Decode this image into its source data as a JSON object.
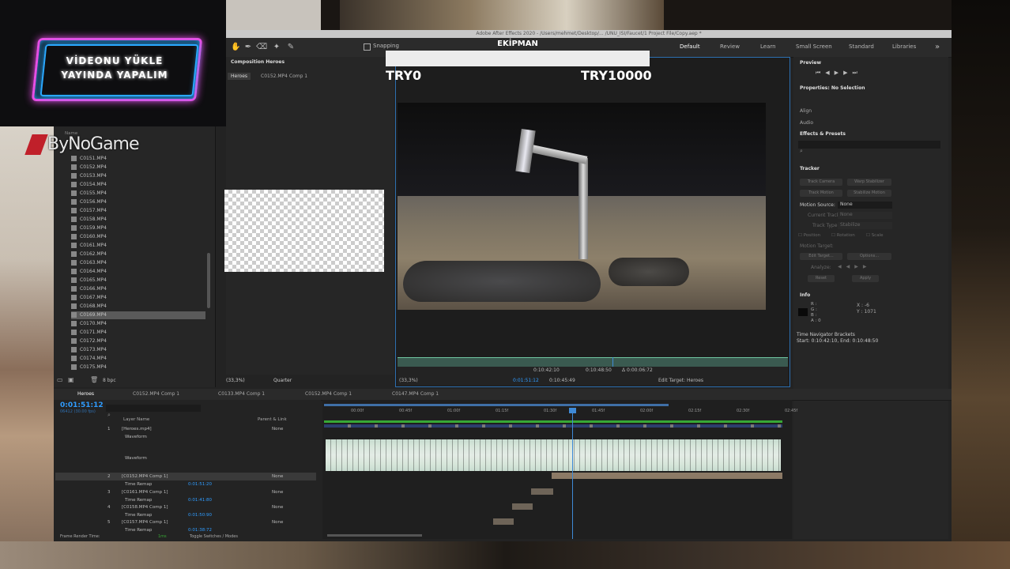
{
  "logo": {
    "line1": "VİDEONU YÜKLE",
    "line2": "YAYINDA YAPALIM"
  },
  "watermark": "ByNoGame",
  "window": {
    "title": "Adobe After Effects 2020 - /Users/mehmet/Desktop/... /UNU_ISI/Faucet/1 Project File/Copy.aep *"
  },
  "toolbar": {
    "workspaces": [
      "Default",
      "Review",
      "Learn",
      "Small Screen",
      "Standard",
      "Libraries"
    ],
    "active_workspace": "Default",
    "snapping_label": "Snapping"
  },
  "overlay": {
    "title": "EKİPMAN",
    "left_value": "TRY0",
    "right_value": "TRY10000"
  },
  "project_panel": {
    "header_name": "Name",
    "files": [
      "C0151.MP4",
      "C0152.MP4",
      "C0153.MP4",
      "C0154.MP4",
      "C0155.MP4",
      "C0156.MP4",
      "C0157.MP4",
      "C0158.MP4",
      "C0159.MP4",
      "C0160.MP4",
      "C0161.MP4",
      "C0162.MP4",
      "C0163.MP4",
      "C0164.MP4",
      "C0165.MP4",
      "C0166.MP4",
      "C0167.MP4",
      "C0168.MP4",
      "C0169.MP4",
      "C0170.MP4",
      "C0171.MP4",
      "C0172.MP4",
      "C0173.MP4",
      "C0174.MP4",
      "C0175.MP4"
    ],
    "selected_index": 18,
    "bpc": "8 bpc"
  },
  "composition_panel": {
    "tab": "Composition Heroes",
    "breadcrumbs": [
      "Heroes",
      "C0152.MP4 Comp 1"
    ],
    "zoom_left": "(33,3%)",
    "quality_left": "Quarter",
    "zoom_right": "(33,3%)",
    "quality_right": "Half",
    "timecode_main": "0:01:51:12",
    "timecode_a": "0:10:42:10",
    "timecode_b": "0:10:48:50",
    "timecode_c": "Δ 0:00:06:72",
    "timecode_d": "0:10:45:49",
    "edit_target": "Edit Target: Heroes"
  },
  "right_panel": {
    "preview": "Preview",
    "properties": "Properties: No Selection",
    "align": "Align",
    "audio": "Audio",
    "effects": "Effects & Presets",
    "tracker": "Tracker",
    "tracker_buttons": [
      "Track Camera",
      "Warp Stabilizer",
      "Track Motion",
      "Stabilize Motion"
    ],
    "motion_source_label": "Motion Source:",
    "motion_source_value": "None",
    "current_track_label": "Current Track:",
    "current_track_value": "None",
    "track_type_label": "Track Type:",
    "track_type_value": "Stabilize",
    "checks": [
      "Position",
      "Rotation",
      "Scale"
    ],
    "motion_target": "Motion Target:",
    "edit_target_btn": "Edit Target...",
    "options_btn": "Options...",
    "analyze": "Analyze:",
    "reset": "Reset",
    "apply": "Apply",
    "info": "Info",
    "info_rgb": [
      "R :",
      "G :",
      "B :",
      "A : 0"
    ],
    "info_x": "X : -6",
    "info_y": "Y : 1071",
    "time_nav": "Time Navigator Brackets",
    "time_nav_values": "Start: 0:10:42:10, End: 0:10:48:50"
  },
  "timeline": {
    "tabs": [
      "Heroes",
      "C0152.MP4 Comp 1",
      "C0133.MP4 Comp 1",
      "C0152.MP4 Comp 1",
      "C0147.MP4 Comp 1"
    ],
    "timecode": "0:01:51:12",
    "timecode_sub": "06412 (30.00 fps)",
    "ruler": [
      "00:00f",
      "00:45f",
      "01:00f",
      "01:15f",
      "01:30f",
      "01:45f",
      "02:00f",
      "02:15f",
      "02:30f",
      "02:45f"
    ],
    "col_layer_name": "Layer Name",
    "col_parent": "Parent & Link",
    "layers": [
      {
        "num": "1",
        "name": "[Heroes.mp4]",
        "parent": "None"
      },
      {
        "num": "",
        "name": "Waveform",
        "parent": ""
      },
      {
        "num": "",
        "name": "Waveform",
        "parent": ""
      },
      {
        "num": "2",
        "name": "[C0152.MP4 Comp 1]",
        "parent": "None"
      },
      {
        "num": "",
        "name": "Time Remap",
        "parent": "0:01:51:20"
      },
      {
        "num": "3",
        "name": "[C0161.MP4 Comp 1]",
        "parent": "None"
      },
      {
        "num": "",
        "name": "Time Remap",
        "parent": "0:01:41:80"
      },
      {
        "num": "4",
        "name": "[C0158.MP4 Comp 1]",
        "parent": "None"
      },
      {
        "num": "",
        "name": "Time Remap",
        "parent": "0:01:50:90"
      },
      {
        "num": "5",
        "name": "[C0157.MP4 Comp 1]",
        "parent": "None"
      },
      {
        "num": "",
        "name": "Time Remap",
        "parent": "0:01:38:72"
      }
    ],
    "render_label": "Frame Render Time:",
    "render_value": "1ms",
    "toggle_label": "Toggle Switches / Modes"
  },
  "colors": {
    "accent": "#2f9cff",
    "neon_pink": "#e84fe6",
    "neon_blue": "#2aa8ff",
    "green": "#37a835"
  }
}
